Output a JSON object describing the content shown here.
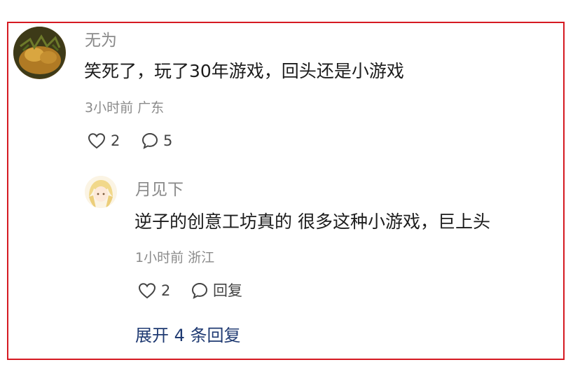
{
  "comment": {
    "username": "无为",
    "text": "笑死了，玩了30年游戏，回头还是小游戏",
    "time": "3小时前",
    "location": "广东",
    "likes": "2",
    "replies": "5"
  },
  "reply": {
    "username": "月见下",
    "text": "逆子的创意工坊真的 很多这种小游戏，巨上头",
    "time": "1小时前",
    "location": "浙江",
    "likes": "2",
    "reply_label": "回复"
  },
  "expand_label": "展开 4 条回复",
  "colors": {
    "frame": "#d51a22",
    "link": "#1f3a72",
    "muted": "#8a8a8a",
    "text": "#1c1c1c"
  },
  "icons": [
    "heart-icon",
    "comment-icon"
  ]
}
